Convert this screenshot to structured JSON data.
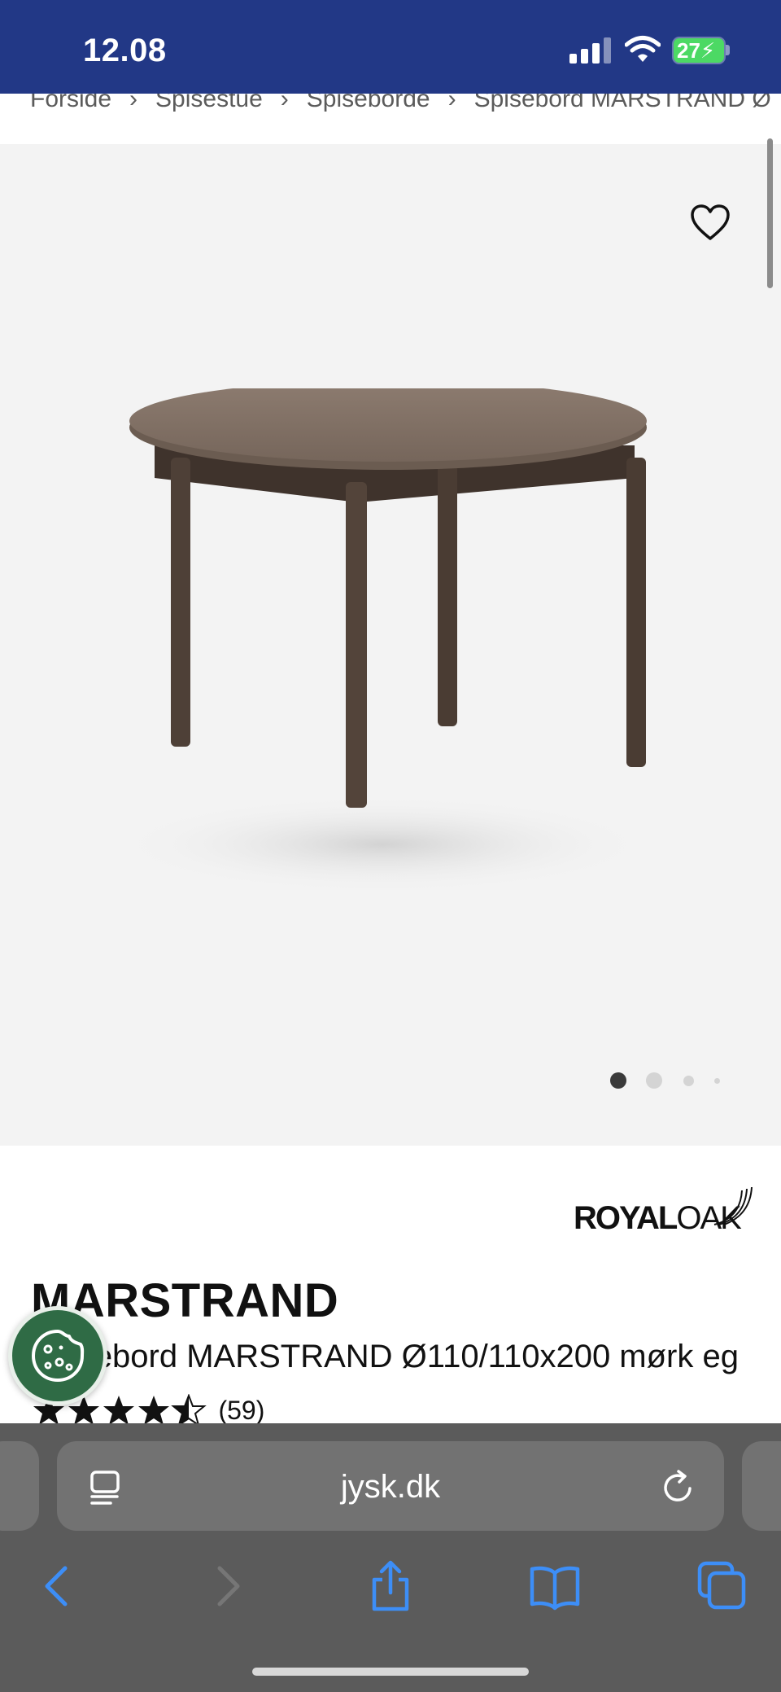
{
  "status_bar": {
    "time": "12.08",
    "battery": "27"
  },
  "breadcrumb": [
    "Forside",
    "Spisestue",
    "Spiseborde",
    "Spisebord MARSTRAND Ø"
  ],
  "gallery": {
    "slide_count": 4,
    "active_slide": 1
  },
  "brand": {
    "part1": "ROYAL",
    "part2": "OAK"
  },
  "product": {
    "title": "MARSTRAND",
    "subtitle": "Spisebord MARSTRAND Ø110/110x200 mørk eg",
    "rating": 4.5,
    "review_count": "(59)"
  },
  "browser": {
    "url": "jysk.dk"
  },
  "colors": {
    "status_bar": "#223886",
    "cookie_button": "#2f6b45",
    "safari_icons": "#3d8ef7",
    "gallery_bg": "#f3f3f3"
  }
}
